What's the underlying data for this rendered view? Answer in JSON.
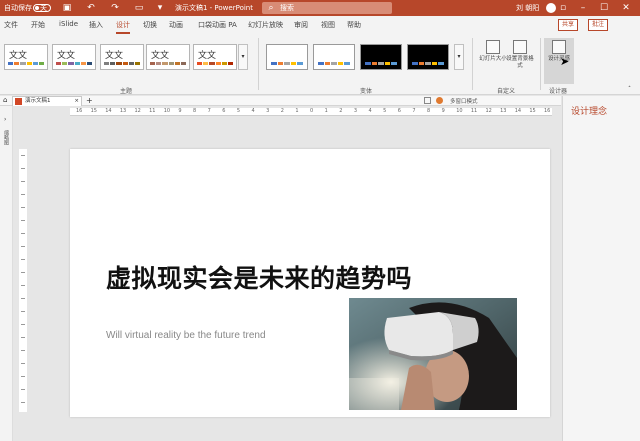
{
  "titlebar": {
    "autosave": "自动保存",
    "autosave_state": "关",
    "doc_title": "演示文稿1 - PowerPoint",
    "search": "搜索",
    "user": "刘 朝阳",
    "bg_color": "#b7472a"
  },
  "menu": {
    "tabs": [
      "文件",
      "开始",
      "iSlide",
      "插入",
      "设计",
      "切换",
      "动画",
      "口袋动画 PA",
      "幻灯片放映",
      "审阅",
      "视图",
      "帮助"
    ],
    "active_tab": "设计",
    "share": "共享",
    "comment": "批注"
  },
  "ribbon": {
    "themes": [
      {
        "label": "文文",
        "colors": [
          "#4472c4",
          "#ed7d31",
          "#a5a5a5",
          "#ffc000",
          "#5b9bd5",
          "#70ad47"
        ]
      },
      {
        "label": "文文",
        "colors": [
          "#c0504d",
          "#9bbb59",
          "#8064a2",
          "#4bacc6",
          "#f79646",
          "#2c4d75"
        ]
      },
      {
        "label": "文文",
        "colors": [
          "#7f7f7f",
          "#5f5f5f",
          "#9e480e",
          "#c55a11",
          "#636363",
          "#997300"
        ]
      },
      {
        "label": "文文",
        "colors": [
          "#a5644e",
          "#b58b80",
          "#c3986d",
          "#a19574",
          "#c17529",
          "#8c6a5a"
        ]
      },
      {
        "label": "文文",
        "colors": [
          "#e84c22",
          "#ffbd47",
          "#b64926",
          "#ff8427",
          "#cc9900",
          "#b22600"
        ]
      }
    ],
    "themes_group": "主题",
    "variants": [
      {
        "bg": "#ffffff",
        "colors": [
          "#4472c4",
          "#ed7d31",
          "#a5a5a5",
          "#ffc000",
          "#5b9bd5"
        ]
      },
      {
        "bg": "#ffffff",
        "colors": [
          "#4472c4",
          "#ed7d31",
          "#a5a5a5",
          "#ffc000",
          "#5b9bd5"
        ]
      },
      {
        "bg": "#000000",
        "colors": [
          "#4472c4",
          "#ed7d31",
          "#a5a5a5",
          "#ffc000",
          "#5b9bd5"
        ]
      },
      {
        "bg": "#000000",
        "colors": [
          "#4472c4",
          "#ed7d31",
          "#a5a5a5",
          "#ffc000",
          "#5b9bd5"
        ]
      }
    ],
    "variants_group": "变体",
    "slide_size": "幻灯片大小",
    "format_bg": "设置背景格式",
    "customize_group": "自定义",
    "design_ideas": "设计灵感",
    "designer_group": "设计器"
  },
  "tabstrip": {
    "doc_tab": "演示文稿1",
    "multipage": "多窗口模式"
  },
  "ruler": {
    "labels": [
      "16",
      "15",
      "14",
      "13",
      "12",
      "11",
      "10",
      "9",
      "8",
      "7",
      "6",
      "5",
      "4",
      "3",
      "2",
      "1",
      "0",
      "1",
      "2",
      "3",
      "4",
      "5",
      "6",
      "7",
      "8",
      "9",
      "10",
      "11",
      "12",
      "13",
      "14",
      "15",
      "16"
    ]
  },
  "leftpane": {
    "label": "缩略图"
  },
  "slide": {
    "title": "虚拟现实会是未来的趋势吗",
    "subtitle": "Will virtual reality be the future trend"
  },
  "designpane": {
    "title": "设计理念"
  }
}
